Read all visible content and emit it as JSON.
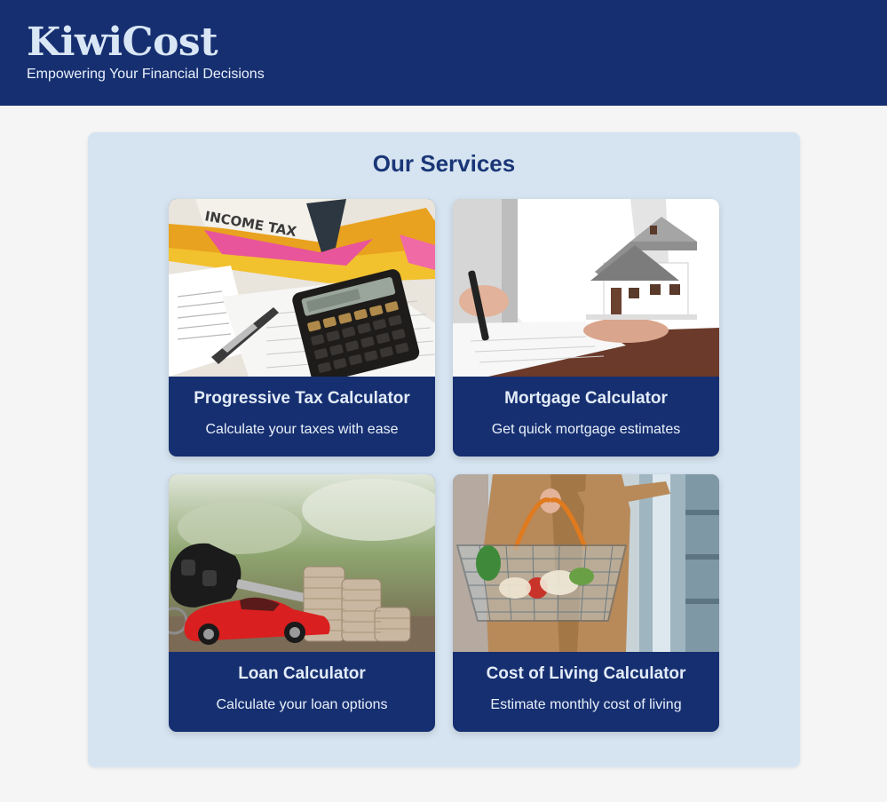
{
  "header": {
    "brand": "KiwiCost",
    "tagline": "Empowering Your Financial Decisions"
  },
  "services": {
    "title": "Our Services",
    "cards": [
      {
        "title": "Progressive Tax Calculator",
        "description": "Calculate your taxes with ease",
        "image_icon": "tax-calculator-photo",
        "image_text": "INCOME TAX"
      },
      {
        "title": "Mortgage Calculator",
        "description": "Get quick mortgage estimates",
        "image_icon": "house-model-photo"
      },
      {
        "title": "Loan Calculator",
        "description": "Calculate your loan options",
        "image_icon": "car-coins-photo"
      },
      {
        "title": "Cost of Living Calculator",
        "description": "Estimate monthly cost of living",
        "image_icon": "grocery-basket-photo"
      }
    ]
  },
  "colors": {
    "header_bg": "#162f70",
    "page_bg": "#f5f5f5",
    "panel_bg": "#d6e4f1",
    "card_bg": "#162f70",
    "title_text": "#1a3677"
  }
}
